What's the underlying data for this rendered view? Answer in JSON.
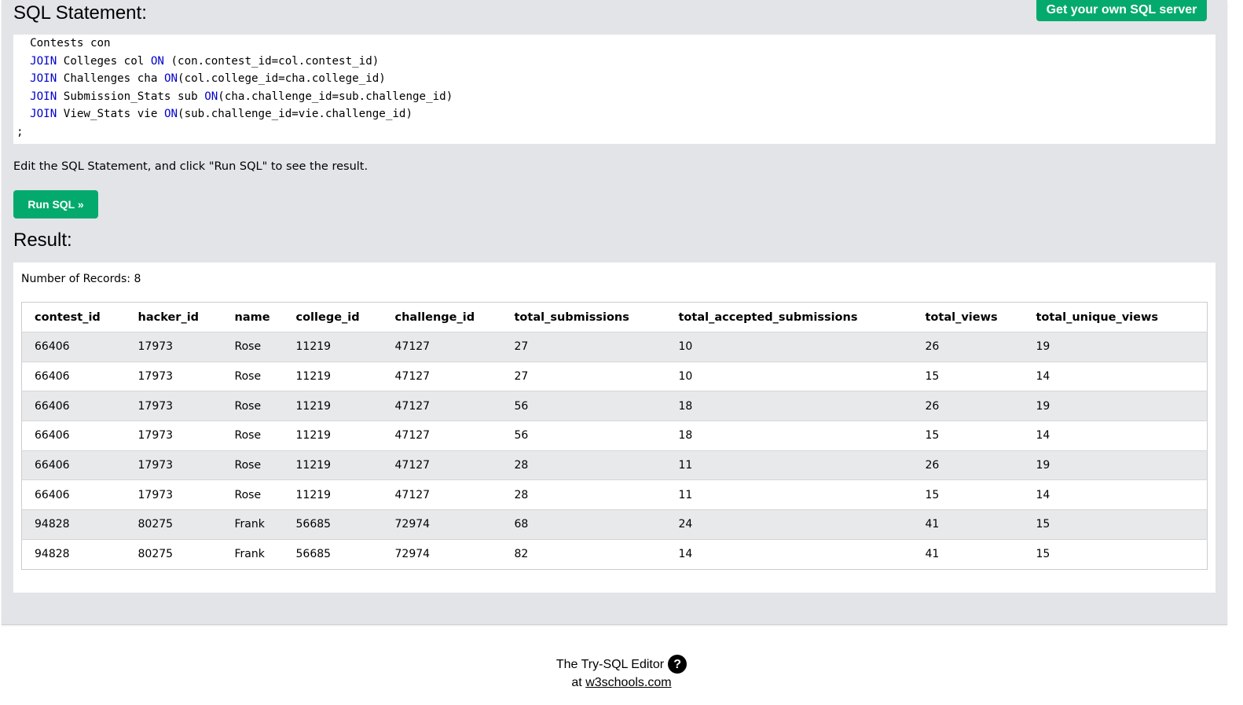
{
  "header": {
    "sql_heading": "SQL Statement:",
    "own_server_label": "Get your own SQL server"
  },
  "editor": {
    "lines": [
      [
        {
          "t": "  Contests con",
          "k": false
        }
      ],
      [
        {
          "t": "  ",
          "k": false
        },
        {
          "t": "JOIN",
          "k": true
        },
        {
          "t": " Colleges col ",
          "k": false
        },
        {
          "t": "ON",
          "k": true
        },
        {
          "t": " (con.contest_id=col.contest_id)",
          "k": false
        }
      ],
      [
        {
          "t": "  ",
          "k": false
        },
        {
          "t": "JOIN",
          "k": true
        },
        {
          "t": " Challenges cha ",
          "k": false
        },
        {
          "t": "ON",
          "k": true
        },
        {
          "t": "(col.college_id=cha.college_id)",
          "k": false
        }
      ],
      [
        {
          "t": "  ",
          "k": false
        },
        {
          "t": "JOIN",
          "k": true
        },
        {
          "t": " Submission_Stats sub ",
          "k": false
        },
        {
          "t": "ON",
          "k": true
        },
        {
          "t": "(cha.challenge_id=sub.challenge_id)",
          "k": false
        }
      ],
      [
        {
          "t": "  ",
          "k": false
        },
        {
          "t": "JOIN",
          "k": true
        },
        {
          "t": " View_Stats vie ",
          "k": false
        },
        {
          "t": "ON",
          "k": true
        },
        {
          "t": "(sub.challenge_id=vie.challenge_id)",
          "k": false
        }
      ],
      [
        {
          "t": ";",
          "k": false
        }
      ]
    ],
    "keyword_color": "#0000cd"
  },
  "hint": "Edit the SQL Statement, and click \"Run SQL\" to see the result.",
  "run_button_label": "Run SQL »",
  "result": {
    "heading": "Result:",
    "records_label": "Number of Records: 8",
    "columns": [
      "contest_id",
      "hacker_id",
      "name",
      "college_id",
      "challenge_id",
      "total_submissions",
      "total_accepted_submissions",
      "total_views",
      "total_unique_views"
    ],
    "rows": [
      [
        "66406",
        "17973",
        "Rose",
        "11219",
        "47127",
        "27",
        "10",
        "26",
        "19"
      ],
      [
        "66406",
        "17973",
        "Rose",
        "11219",
        "47127",
        "27",
        "10",
        "15",
        "14"
      ],
      [
        "66406",
        "17973",
        "Rose",
        "11219",
        "47127",
        "56",
        "18",
        "26",
        "19"
      ],
      [
        "66406",
        "17973",
        "Rose",
        "11219",
        "47127",
        "56",
        "18",
        "15",
        "14"
      ],
      [
        "66406",
        "17973",
        "Rose",
        "11219",
        "47127",
        "28",
        "11",
        "26",
        "19"
      ],
      [
        "66406",
        "17973",
        "Rose",
        "11219",
        "47127",
        "28",
        "11",
        "15",
        "14"
      ],
      [
        "94828",
        "80275",
        "Frank",
        "56685",
        "72974",
        "68",
        "24",
        "41",
        "15"
      ],
      [
        "94828",
        "80275",
        "Frank",
        "56685",
        "72974",
        "82",
        "14",
        "41",
        "15"
      ]
    ]
  },
  "footer": {
    "line1": "The Try-SQL Editor",
    "help_glyph": "?",
    "at_text": "at",
    "link_text": "w3schools.com"
  },
  "colors": {
    "accent": "#04aa6d",
    "panel_bg": "#e3e4e8",
    "row_stripe": "#e7e9eb"
  }
}
